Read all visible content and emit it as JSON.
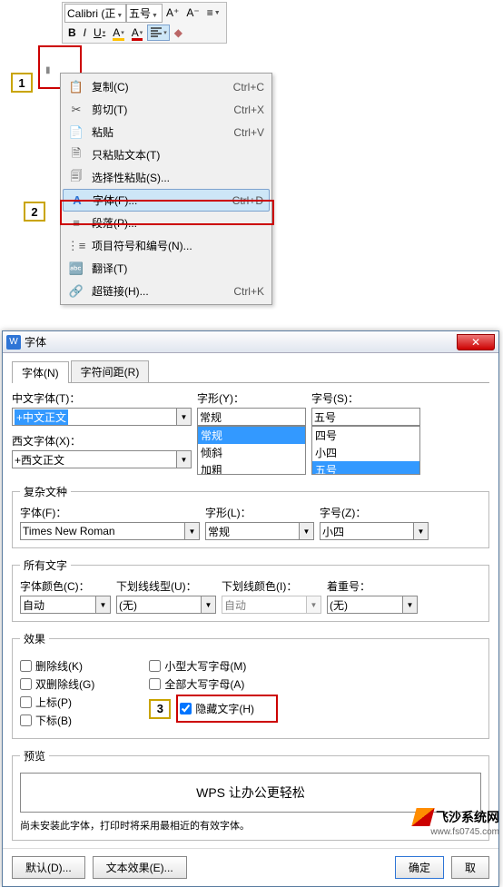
{
  "toolbar": {
    "font_name": "Calibri (正",
    "font_size": "五号",
    "a_plus": "A⁺",
    "a_minus": "A⁻"
  },
  "context_menu": {
    "items": [
      {
        "icon": "📋",
        "label": "复制(C)",
        "shortcut": "Ctrl+C"
      },
      {
        "icon": "✂",
        "label": "剪切(T)",
        "shortcut": "Ctrl+X"
      },
      {
        "icon": "📄",
        "label": "粘贴",
        "shortcut": "Ctrl+V"
      },
      {
        "icon": "🗎",
        "label": "只粘贴文本(T)",
        "shortcut": ""
      },
      {
        "icon": "🗐",
        "label": "选择性粘贴(S)...",
        "shortcut": ""
      },
      {
        "icon": "A",
        "label": "字体(F)...",
        "shortcut": "Ctrl+D"
      },
      {
        "icon": "≡",
        "label": "段落(P)...",
        "shortcut": ""
      },
      {
        "icon": "⋮≡",
        "label": "项目符号和编号(N)...",
        "shortcut": ""
      },
      {
        "icon": "🔤",
        "label": "翻译(T)",
        "shortcut": ""
      },
      {
        "icon": "🔗",
        "label": "超链接(H)...",
        "shortcut": "Ctrl+K"
      }
    ]
  },
  "dialog": {
    "title": "字体",
    "tabs": {
      "font": "字体(N)",
      "spacing": "字符间距(R)"
    },
    "cn_font_label": "中文字体(T)：",
    "cn_font_value": "+中文正文",
    "en_font_label": "西文字体(X)：",
    "en_font_value": "+西文正文",
    "style_label": "字形(Y)：",
    "style_value": "常规",
    "style_options": [
      "常规",
      "倾斜",
      "加粗"
    ],
    "size_label": "字号(S)：",
    "size_value": "五号",
    "size_options": [
      "四号",
      "小四",
      "五号"
    ],
    "complex_legend": "复杂文种",
    "complex_font_label": "字体(F)：",
    "complex_font_value": "Times New Roman",
    "complex_style_label": "字形(L)：",
    "complex_style_value": "常规",
    "complex_size_label": "字号(Z)：",
    "complex_size_value": "小四",
    "all_text_legend": "所有文字",
    "color_label": "字体颜色(C)：",
    "color_value": "自动",
    "under_label": "下划线线型(U)：",
    "under_value": "(无)",
    "ucolor_label": "下划线颜色(I)：",
    "ucolor_value": "自动",
    "emph_label": "着重号：",
    "emph_value": "(无)",
    "effects_legend": "效果",
    "checks_left": [
      {
        "label": "删除线(K)",
        "checked": false
      },
      {
        "label": "双删除线(G)",
        "checked": false
      },
      {
        "label": "上标(P)",
        "checked": false
      },
      {
        "label": "下标(B)",
        "checked": false
      }
    ],
    "checks_right": [
      {
        "label": "小型大写字母(M)",
        "checked": false
      },
      {
        "label": "全部大写字母(A)",
        "checked": false
      },
      {
        "label": "隐藏文字(H)",
        "checked": true
      }
    ],
    "preview_legend": "预览",
    "preview_text": "WPS 让办公更轻松",
    "preview_note": "尚未安装此字体，打印时将采用最相近的有效字体。",
    "btn_default": "默认(D)...",
    "btn_texteffect": "文本效果(E)...",
    "btn_ok": "确定",
    "btn_cancel": "取"
  },
  "steps": {
    "s1": "1",
    "s2": "2",
    "s3": "3"
  },
  "watermark": {
    "name": "飞沙系统网",
    "url": "www.fs0745.com"
  }
}
